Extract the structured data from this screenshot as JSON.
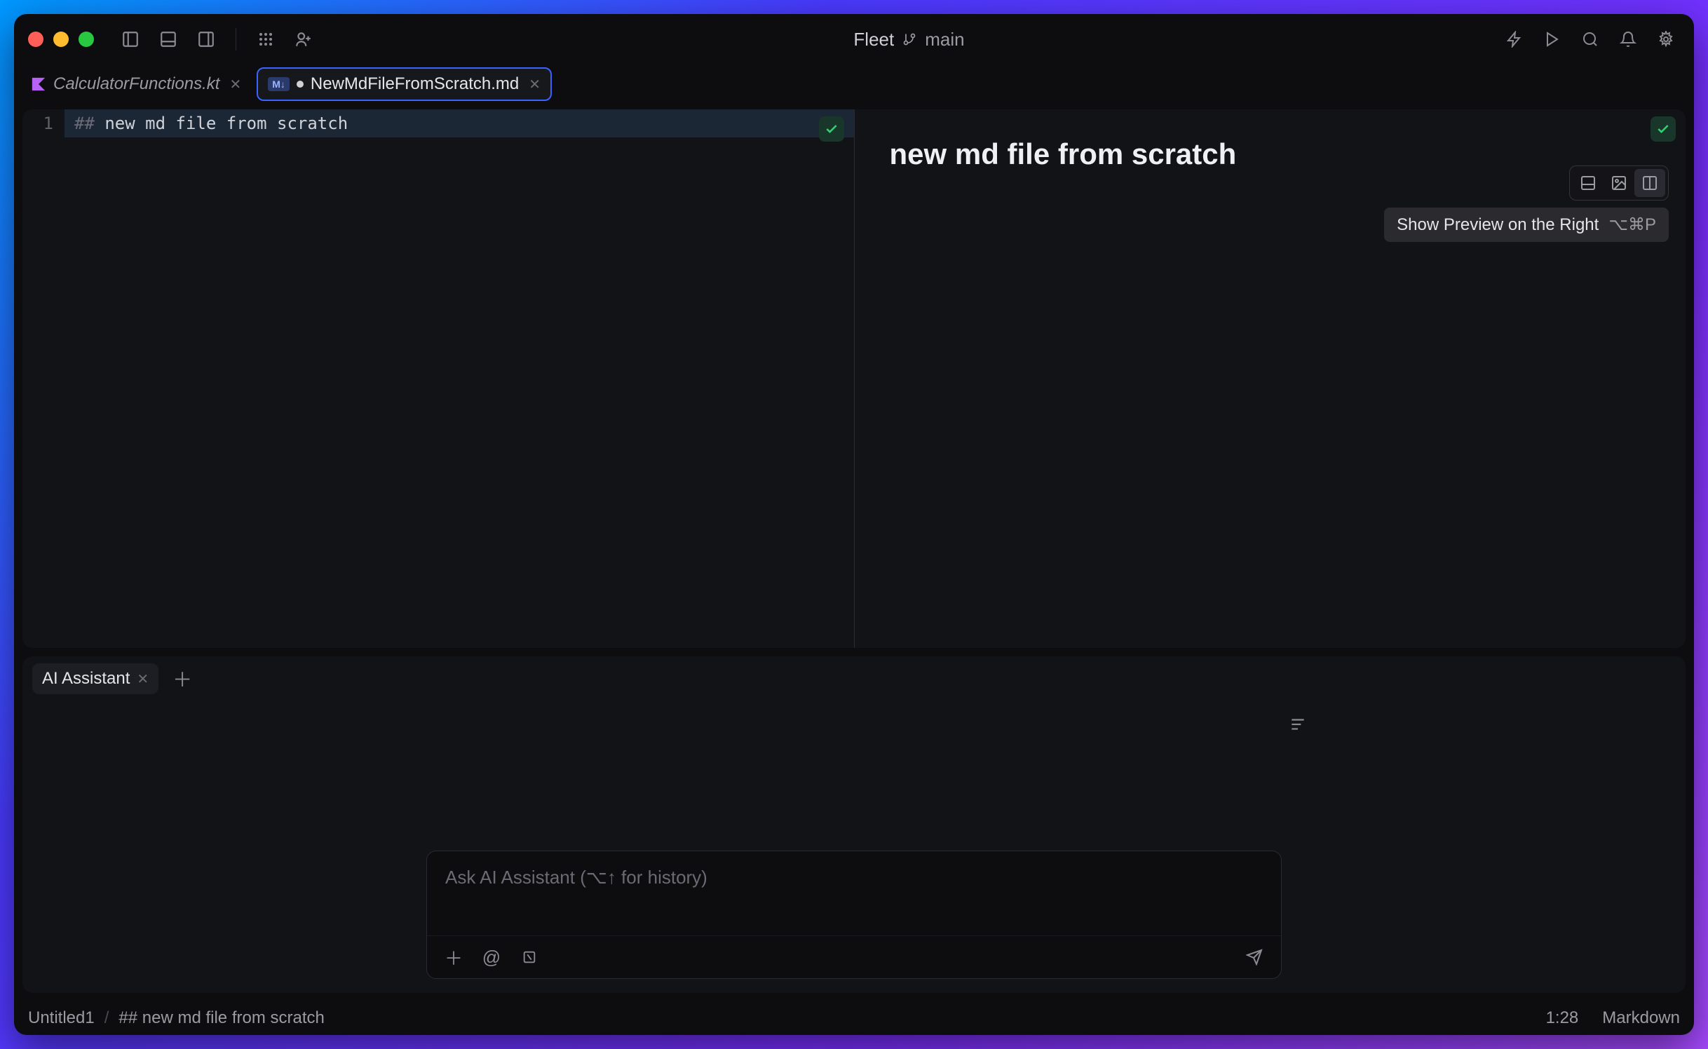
{
  "titlebar": {
    "app_name": "Fleet",
    "branch": "main"
  },
  "tabs": [
    {
      "label": "CalculatorFunctions.kt",
      "dirty": false,
      "icon": "kotlin"
    },
    {
      "label": "NewMdFileFromScratch.md",
      "dirty": true,
      "icon": "markdown"
    }
  ],
  "editor": {
    "line_number": "1",
    "line_prefix": "## ",
    "line_text": "new md file from scratch"
  },
  "preview": {
    "heading": "new md file from scratch"
  },
  "tooltip": {
    "text": "Show Preview on the Right",
    "shortcut": "⌥⌘P"
  },
  "ai_panel": {
    "tab_label": "AI Assistant",
    "placeholder": "Ask AI Assistant (⌥↑ for history)"
  },
  "statusbar": {
    "filename": "Untitled1",
    "breadcrumb": "## new md file from scratch",
    "position": "1:28",
    "language": "Markdown"
  }
}
